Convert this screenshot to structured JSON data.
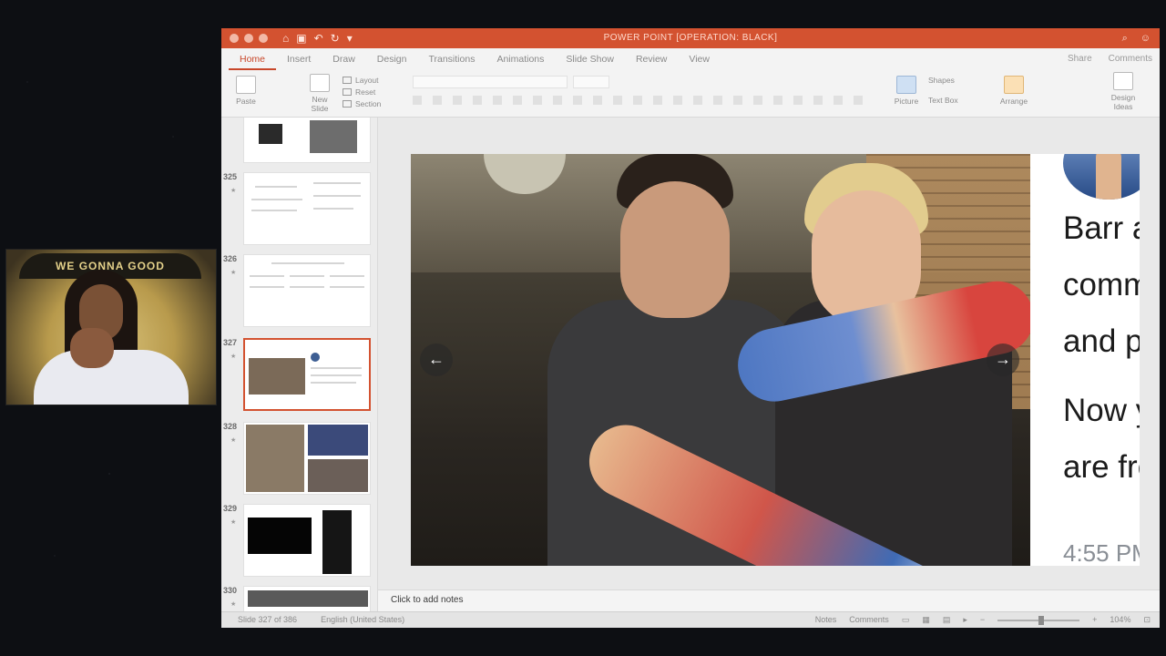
{
  "webcam": {
    "banner_text": "WE GONNA GOOD"
  },
  "window": {
    "title": "POWER POINT [OPERATION: BLACK]",
    "quick_access": [
      "home-icon",
      "save-icon",
      "undo-icon",
      "redo-icon",
      "more-icon"
    ],
    "title_right_icons": [
      "search-icon",
      "smiley-icon"
    ]
  },
  "ribbon_tabs": [
    "Home",
    "Insert",
    "Draw",
    "Design",
    "Transitions",
    "Animations",
    "Slide Show",
    "Review",
    "View"
  ],
  "ribbon_right": {
    "share": "Share",
    "comments": "Comments"
  },
  "ribbon": {
    "paste": "Paste",
    "new_slide_line1": "New",
    "new_slide_line2": "Slide",
    "layout": "Layout",
    "reset": "Reset",
    "section": "Section",
    "picture": "Picture",
    "shapes": "Shapes",
    "text_box": "Text Box",
    "arrange": "Arrange",
    "design_ideas_line1": "Design",
    "design_ideas_line2": "Ideas"
  },
  "thumbnails": [
    {
      "number": ""
    },
    {
      "number": "325"
    },
    {
      "number": "326"
    },
    {
      "number": "327",
      "selected": true
    },
    {
      "number": "328"
    },
    {
      "number": "329"
    },
    {
      "number": "330"
    }
  ],
  "slide": {
    "tweet_lines": [
      "Barr a",
      "comm",
      "and pe",
      "Now y",
      "are fre"
    ],
    "tweet_time": "4:55 PM",
    "left_arrow": "←",
    "right_arrow": "→"
  },
  "notes_placeholder": "Click to add notes",
  "status": {
    "slide_counter": "Slide 327 of 386",
    "language": "English (United States)",
    "notes": "Notes",
    "comments": "Comments",
    "zoom": "104%"
  }
}
